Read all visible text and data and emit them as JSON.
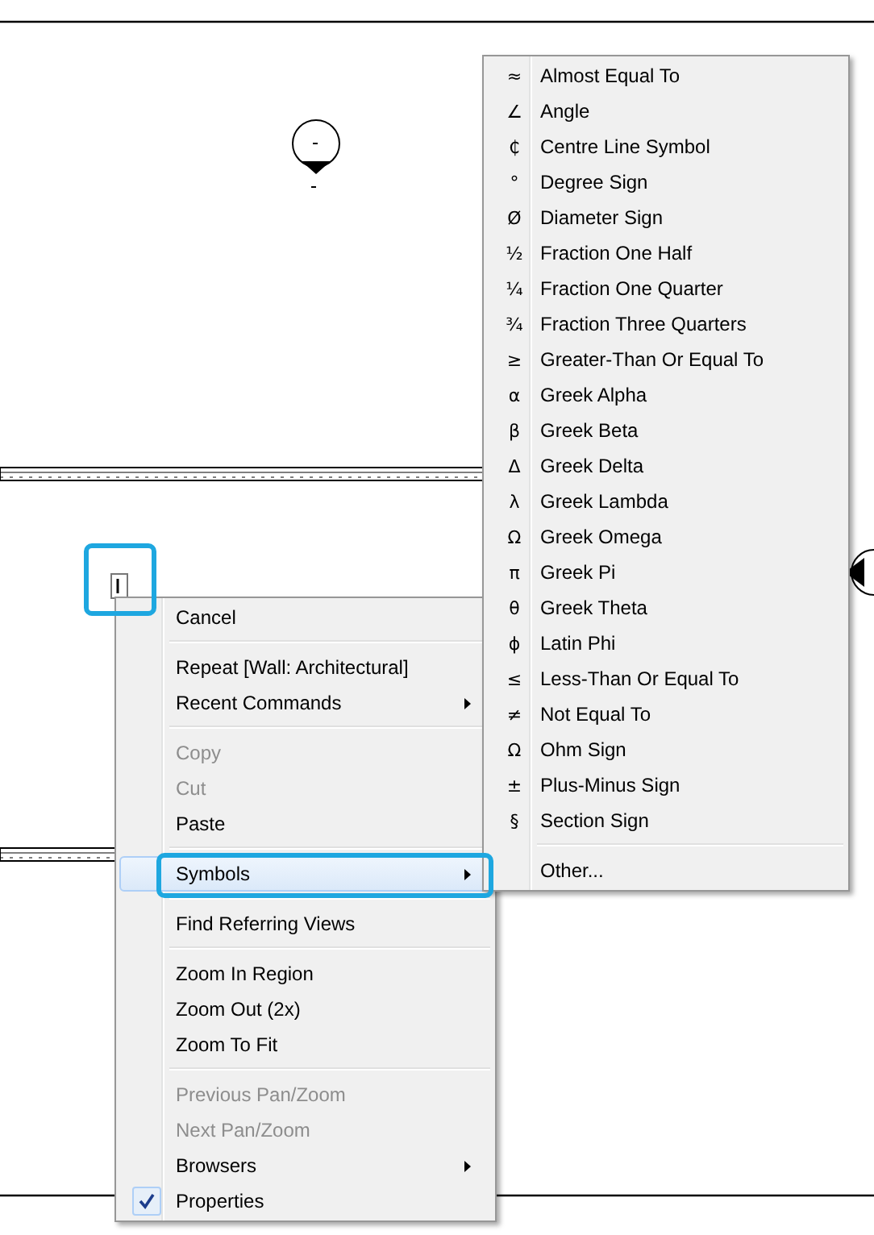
{
  "context_menu": {
    "groups": [
      [
        {
          "label": "Cancel",
          "disabled": false,
          "submenu": false,
          "checked": false,
          "selected": false
        }
      ],
      [
        {
          "label": "Repeat [Wall: Architectural]",
          "disabled": false,
          "submenu": false,
          "checked": false,
          "selected": false
        },
        {
          "label": "Recent Commands",
          "disabled": false,
          "submenu": true,
          "checked": false,
          "selected": false
        }
      ],
      [
        {
          "label": "Copy",
          "disabled": true,
          "submenu": false,
          "checked": false,
          "selected": false
        },
        {
          "label": "Cut",
          "disabled": true,
          "submenu": false,
          "checked": false,
          "selected": false
        },
        {
          "label": "Paste",
          "disabled": false,
          "submenu": false,
          "checked": false,
          "selected": false
        }
      ],
      [
        {
          "label": "Symbols",
          "disabled": false,
          "submenu": true,
          "checked": false,
          "selected": true
        }
      ],
      [
        {
          "label": "Find Referring Views",
          "disabled": false,
          "submenu": false,
          "checked": false,
          "selected": false
        }
      ],
      [
        {
          "label": "Zoom In Region",
          "disabled": false,
          "submenu": false,
          "checked": false,
          "selected": false
        },
        {
          "label": "Zoom Out (2x)",
          "disabled": false,
          "submenu": false,
          "checked": false,
          "selected": false
        },
        {
          "label": "Zoom To Fit",
          "disabled": false,
          "submenu": false,
          "checked": false,
          "selected": false
        }
      ],
      [
        {
          "label": "Previous Pan/Zoom",
          "disabled": true,
          "submenu": false,
          "checked": false,
          "selected": false
        },
        {
          "label": "Next Pan/Zoom",
          "disabled": true,
          "submenu": false,
          "checked": false,
          "selected": false
        },
        {
          "label": "Browsers",
          "disabled": false,
          "submenu": true,
          "checked": false,
          "selected": false
        },
        {
          "label": "Properties",
          "disabled": false,
          "submenu": false,
          "checked": true,
          "selected": false
        }
      ]
    ]
  },
  "symbols_menu": {
    "groups": [
      [
        {
          "symbol": "≈",
          "label": "Almost Equal To"
        },
        {
          "symbol": "∠",
          "label": "Angle"
        },
        {
          "symbol": "₵",
          "label": "Centre Line Symbol"
        },
        {
          "symbol": "°",
          "label": "Degree Sign"
        },
        {
          "symbol": "Ø",
          "label": "Diameter Sign"
        },
        {
          "symbol": "½",
          "label": "Fraction One Half"
        },
        {
          "symbol": "¼",
          "label": "Fraction One Quarter"
        },
        {
          "symbol": "¾",
          "label": "Fraction Three Quarters"
        },
        {
          "symbol": "≥",
          "label": "Greater-Than Or Equal To"
        },
        {
          "symbol": "α",
          "label": "Greek Alpha"
        },
        {
          "symbol": "β",
          "label": "Greek Beta"
        },
        {
          "symbol": "Δ",
          "label": "Greek Delta"
        },
        {
          "symbol": "λ",
          "label": "Greek Lambda"
        },
        {
          "symbol": "Ω",
          "label": "Greek Omega"
        },
        {
          "symbol": "π",
          "label": "Greek Pi"
        },
        {
          "symbol": "θ",
          "label": "Greek Theta"
        },
        {
          "symbol": "ɸ",
          "label": "Latin Phi"
        },
        {
          "symbol": "≤",
          "label": "Less-Than Or Equal To"
        },
        {
          "symbol": "≠",
          "label": "Not Equal To"
        },
        {
          "symbol": "Ω",
          "label": "Ohm Sign"
        },
        {
          "symbol": "±",
          "label": "Plus-Minus Sign"
        },
        {
          "symbol": "§",
          "label": "Section Sign"
        }
      ],
      [
        {
          "label": "Other..."
        }
      ]
    ]
  }
}
